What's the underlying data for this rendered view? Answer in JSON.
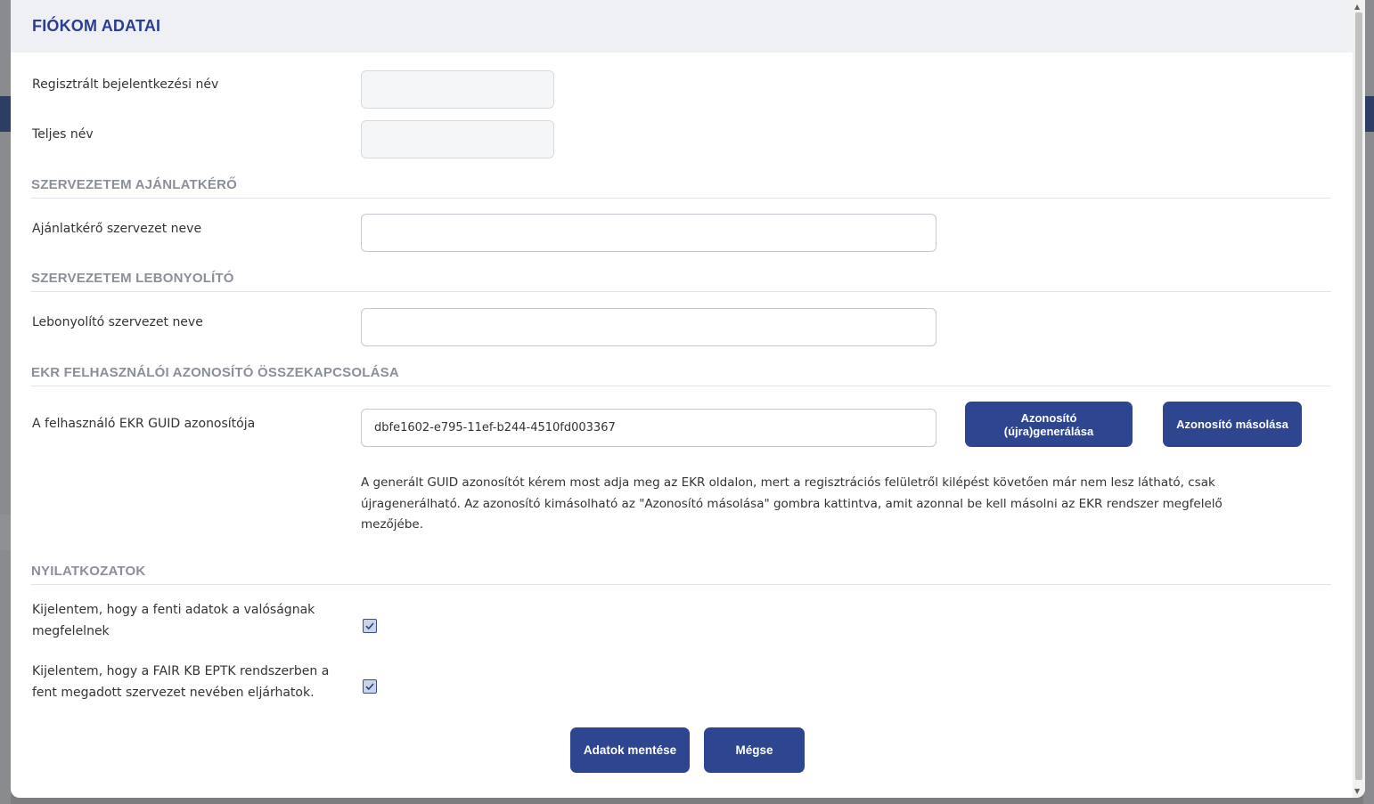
{
  "modal": {
    "title": "FIÓKOM ADATAI"
  },
  "fields": {
    "username_label": "Regisztrált bejelentkezési név",
    "username_value": "",
    "fullname_label": "Teljes név",
    "fullname_value": ""
  },
  "sections": {
    "requester": "SZERVEZETEM AJÁNLATKÉRŐ",
    "organizer": "SZERVEZETEM LEBONYOLÍTÓ",
    "ekr": "EKR FELHASZNÁLÓI AZONOSÍTÓ ÖSSZEKAPCSOLÁSA",
    "declarations": "NYILATKOZATOK"
  },
  "requester": {
    "label": "Ajánlatkérő szervezet neve",
    "value": ""
  },
  "organizer": {
    "label": "Lebonyolító szervezet neve",
    "value": ""
  },
  "ekr": {
    "label": "A felhasználó EKR GUID azonosítója",
    "guid": "dbfe1602-e795-11ef-b244-4510fd003367",
    "regenerate_label_line1": "Azonosító",
    "regenerate_label_line2": "(újra)generálása",
    "copy_label": "Azonosító másolása",
    "help_text": "A generált GUID azonosítót kérem most adja meg az EKR oldalon, mert a regisztrációs felületről kilépést követően már nem lesz látható, csak újragenerálható. Az azonosító kimásolható az \"Azonosító másolása\" gombra kattintva, amit azonnal be kell másolni az EKR rendszer megfelelő mezőjébe."
  },
  "declarations": {
    "decl1_line1": "Kijelentem, hogy a fenti adatok a valóságnak",
    "decl1_line2": "megfelelnek",
    "decl1_checked": true,
    "decl2_line1": "Kijelentem, hogy a FAIR KB EPTK rendszerben a",
    "decl2_line2": "fent megadott szervezet nevében eljárhatok.",
    "decl2_checked": true
  },
  "actions": {
    "save_label": "Adatok mentése",
    "cancel_label": "Mégse"
  },
  "colors": {
    "primary": "#2e4590",
    "title": "#2c3e8f",
    "section": "#8a8f99"
  }
}
